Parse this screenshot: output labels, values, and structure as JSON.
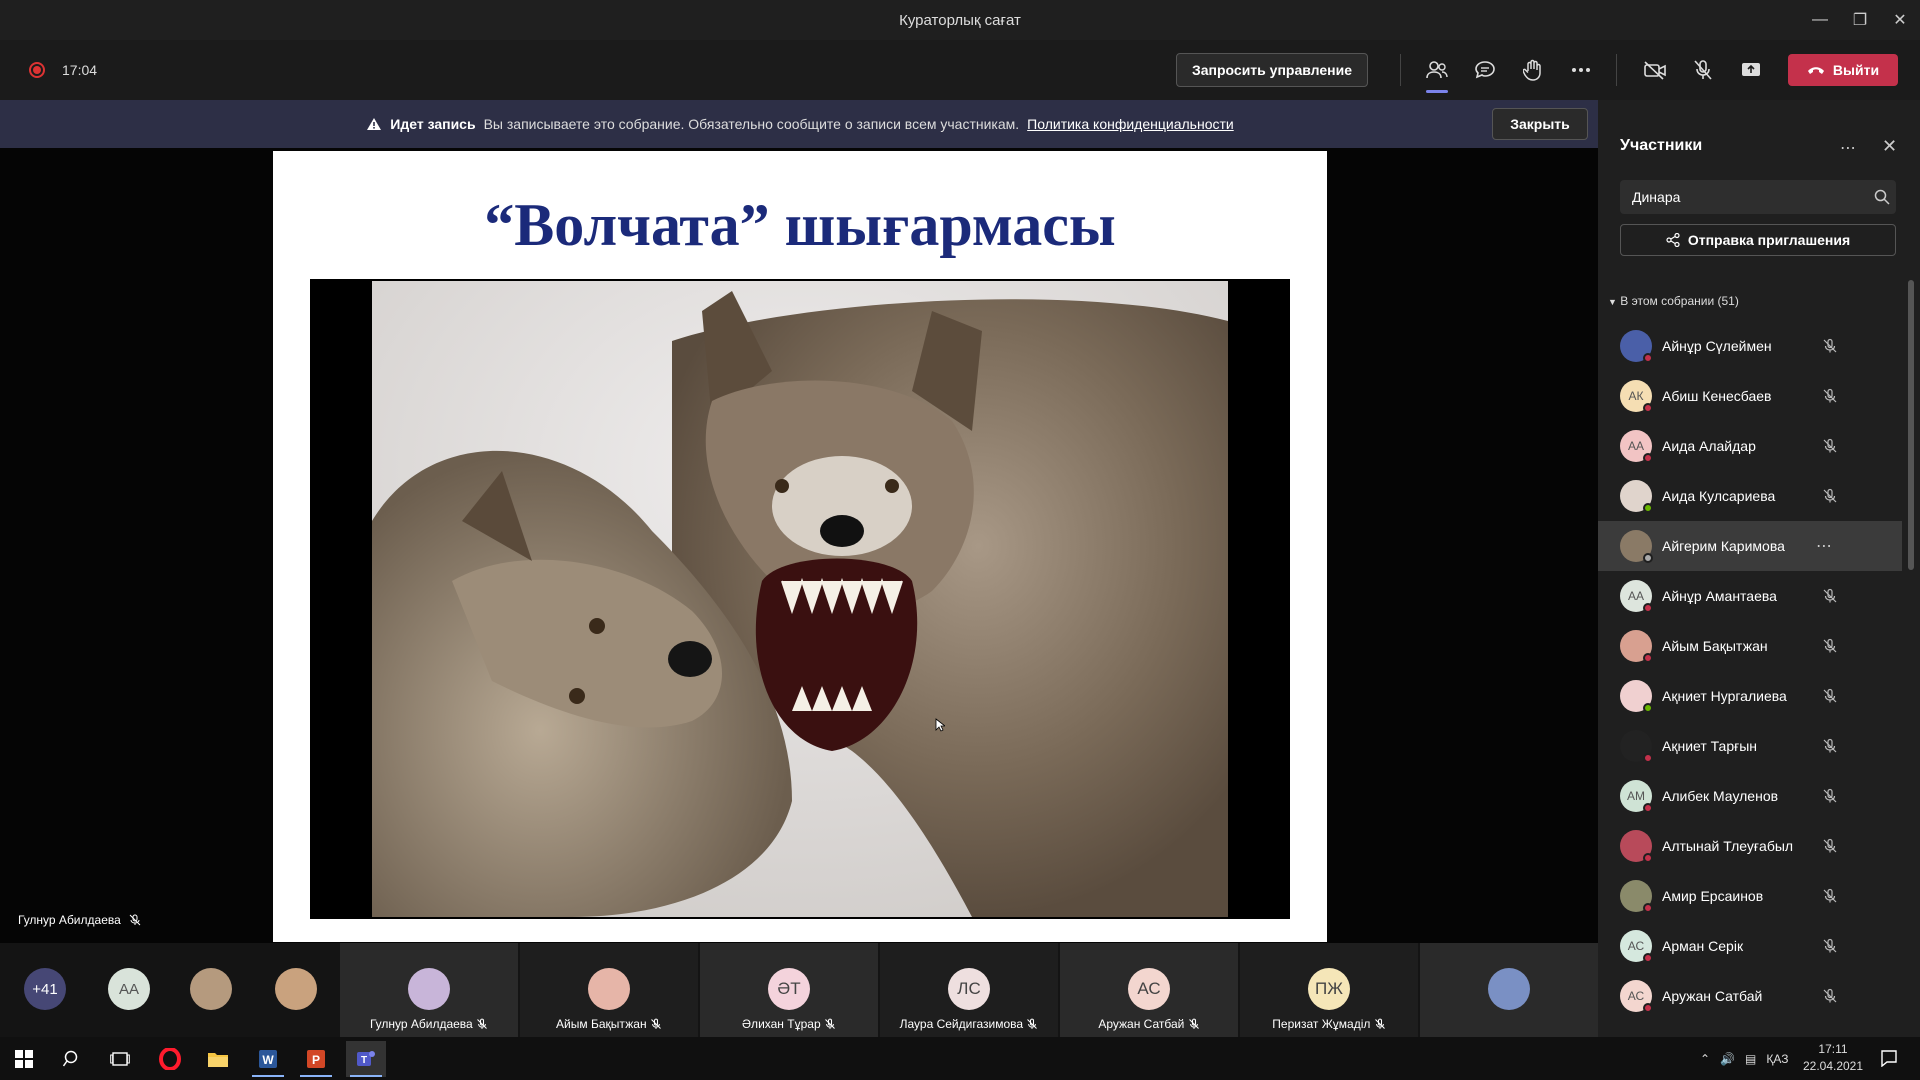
{
  "window": {
    "title": "Кураторлық сағат"
  },
  "toolbar": {
    "timer": "17:04",
    "request_control_label": "Запросить управление",
    "leave_label": "Выйти"
  },
  "banner": {
    "bold": "Идет запись",
    "text": "Вы записываете это собрание. Обязательно сообщите о записи всем участникам.",
    "link": "Политика конфиденциальности",
    "close_label": "Закрыть"
  },
  "slide": {
    "title": "“Волчата” шығармасы"
  },
  "presenter": {
    "name": "Гулнур Абилдаева"
  },
  "gallery": {
    "overflow_count": "+41",
    "small": [
      {
        "initials": "АА",
        "bg": "#d9e3da"
      },
      {
        "initials": "",
        "bg": "#b59a7e"
      },
      {
        "initials": "",
        "bg": "#c9a27e"
      }
    ],
    "tiles": [
      {
        "name": "Гулнур Абилдаева",
        "initials": "",
        "bg": "#c8b5d9"
      },
      {
        "name": "Айым Бақытжан",
        "initials": "",
        "bg": "#e6b5a8"
      },
      {
        "name": "Әлихан Тұрар",
        "initials": "ӘТ",
        "bg": "#f4d3dc"
      },
      {
        "name": "Лаура Сейдигазимова",
        "initials": "ЛС",
        "bg": "#eedfdf"
      },
      {
        "name": "Аружан Сатбай",
        "initials": "АС",
        "bg": "#f3d6cf"
      },
      {
        "name": "Перизат Жұмаділ",
        "initials": "ПЖ",
        "bg": "#f5e6b8"
      },
      {
        "name": "",
        "initials": "",
        "bg": "#7a90c4"
      }
    ]
  },
  "panel": {
    "title": "Участники",
    "search_value": "Динара",
    "invite_label": "Отправка приглашения",
    "section_label": "В этом собрании (51)",
    "participants": [
      {
        "name": "Айнұр Сүлеймен",
        "initials": "",
        "bg": "#4a5fa8",
        "status": "busy",
        "muted": true
      },
      {
        "name": "Абиш Кенесбаев",
        "initials": "АК",
        "bg": "#f5deb3",
        "status": "busy",
        "muted": true
      },
      {
        "name": "Аида Алайдар",
        "initials": "АА",
        "bg": "#f2c4c4",
        "status": "busy",
        "muted": true
      },
      {
        "name": "Аида Кулсариева",
        "initials": "",
        "bg": "#e0d4cc",
        "status": "available",
        "muted": true
      },
      {
        "name": "Айгерим Каримова",
        "initials": "",
        "bg": "#8a7a66",
        "status": "offline",
        "muted": false
      },
      {
        "name": "Айнұр Амантаева",
        "initials": "АА",
        "bg": "#dde5dd",
        "status": "busy",
        "muted": true
      },
      {
        "name": "Айым Бақытжан",
        "initials": "",
        "bg": "#d8a090",
        "status": "busy",
        "muted": true
      },
      {
        "name": "Ақниет Нургалиева",
        "initials": "",
        "bg": "#f0d0d0",
        "status": "available",
        "muted": true
      },
      {
        "name": "Ақниет Тарғын",
        "initials": "",
        "bg": "#222222",
        "status": "busy",
        "muted": true
      },
      {
        "name": "Алибек Мауленов",
        "initials": "АМ",
        "bg": "#cfe3d5",
        "status": "busy",
        "muted": true
      },
      {
        "name": "Алтынай Тлеуғабыл",
        "initials": "",
        "bg": "#b84a5a",
        "status": "busy",
        "muted": true
      },
      {
        "name": "Амир Ерсаинов",
        "initials": "",
        "bg": "#8a8a6a",
        "status": "busy",
        "muted": true
      },
      {
        "name": "Арман Серік",
        "initials": "АС",
        "bg": "#d5e8de",
        "status": "busy",
        "muted": true
      },
      {
        "name": "Аружан Сатбай",
        "initials": "АС",
        "bg": "#f3d6cf",
        "status": "busy",
        "muted": true
      }
    ]
  },
  "taskbar": {
    "lang": "ҚАЗ",
    "time": "17:11",
    "date": "22.04.2021"
  },
  "colors": {
    "leave": "#c4314b",
    "accent": "#7b83eb",
    "slide_title": "#1b2a7a"
  }
}
